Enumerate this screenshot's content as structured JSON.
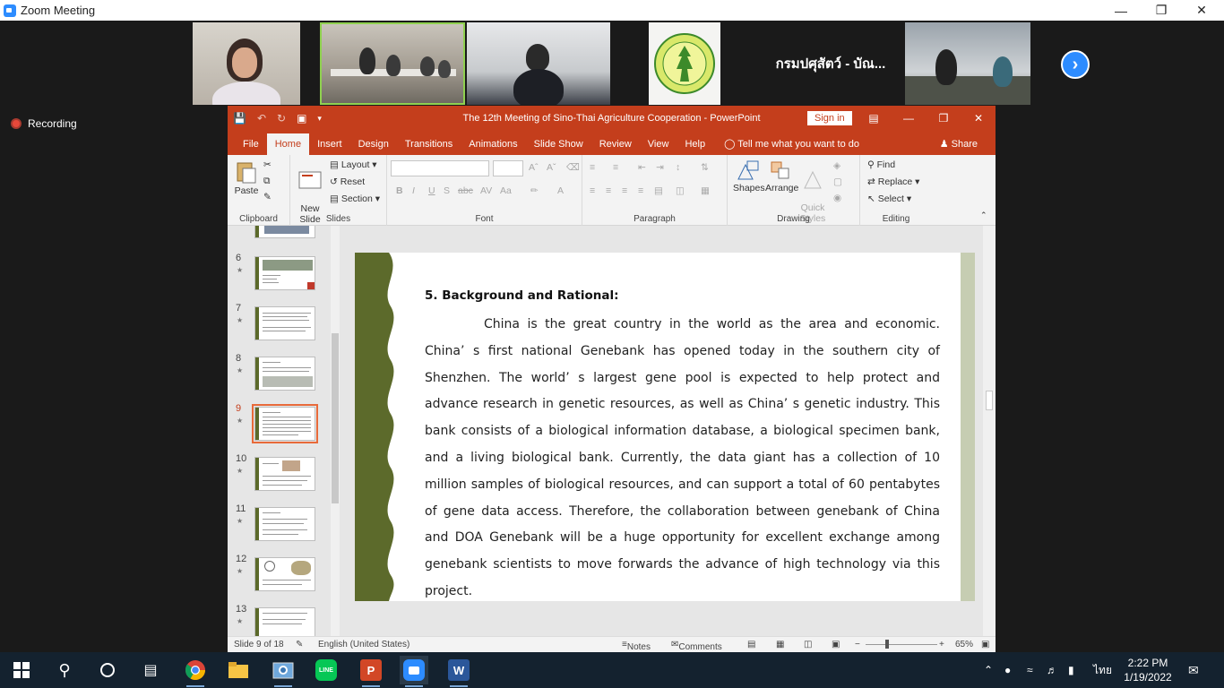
{
  "zoom": {
    "window_title": "Zoom Meeting",
    "recording_label": "Recording",
    "participant_name": "กรมปศุสัตว์ - บัณ..."
  },
  "ppt": {
    "doc_title": "The 12th Meeting of Sino-Thai Agriculture Cooperation  -  PowerPoint",
    "signin_label": "Sign in",
    "tabs": [
      "File",
      "Home",
      "Insert",
      "Design",
      "Transitions",
      "Animations",
      "Slide Show",
      "Review",
      "View",
      "Help"
    ],
    "tell_me": "Tell me what you want to do",
    "share_label": "Share",
    "ribbon": {
      "paste": "Paste",
      "clipboard": "Clipboard",
      "new_slide": "New\nSlide",
      "layout": "Layout",
      "reset": "Reset",
      "section": "Section",
      "slides": "Slides",
      "font": "Font",
      "paragraph": "Paragraph",
      "shapes": "Shapes",
      "arrange": "Arrange",
      "quick_styles": "Quick\nStyles",
      "drawing": "Drawing",
      "find": "Find",
      "replace": "Replace",
      "select": "Select",
      "editing": "Editing"
    },
    "thumbnails": [
      "6",
      "7",
      "8",
      "9",
      "10",
      "11",
      "12",
      "13"
    ],
    "slide": {
      "heading": "5. Background and Rational:",
      "body": "China is the great country in the world as the area and economic. China’ s first national Genebank has opened today in the southern city of Shenzhen. The world’ s largest gene pool is expected to help protect and advance research in genetic resources, as well as China’ s genetic industry. This bank consists of a biological information database, a biological specimen bank, and a living biological bank. Currently, the data giant has a collection of 10 million samples of biological resources, and can support a total of 60 pentabytes of gene data access. Therefore, the collaboration between genebank of China and DOA Genebank will be a huge opportunity for excellent exchange among genebank scientists to move forwards the advance of high technology via this project."
    },
    "status": {
      "slide_of": "Slide 9 of 18",
      "language": "English (United States)",
      "notes": "Notes",
      "comments": "Comments",
      "zoom": "65%"
    }
  },
  "taskbar": {
    "time": "2:22 PM",
    "date": "1/19/2022",
    "input_lang": "ไทย"
  },
  "colors": {
    "ppt_accent": "#c43e1c",
    "zoom_blue": "#2d8cff",
    "slide_band": "#5c6a2b",
    "taskbar": "#14222f"
  }
}
